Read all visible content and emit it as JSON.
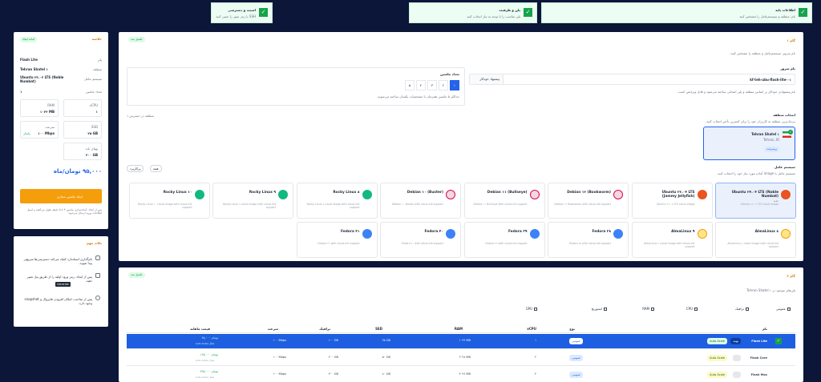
{
  "steps": [
    {
      "title": "اطلاعات پایه",
      "desc": "نام، منطقه و سیستم‌عامل را مشخص کنید"
    },
    {
      "title": "پلن و ظرفیت",
      "desc": "پلن مناسب را با توجه به نیاز انتخاب کنید"
    },
    {
      "title": "امنیت و دسترسی",
      "desc": "SSH یا رمز عبور را تعیین کنید"
    }
  ],
  "basic": {
    "step_pill": "تکمیل شد",
    "heading": "گام ۱",
    "subtitle": "نام سرور، سیستم‌عامل و منطقه را مشخص کنید.",
    "server_name_label": "نام سرور",
    "server_name_value": "kf-teh-ubu-flash-lite-۰۱",
    "auto_button": "پیشنهاد خودکار",
    "server_name_hint": "نام پیشنهادی خودکار بر اساس منطقه و پلن انتخابی ساخته می‌شود و قابل ویرایش است.",
    "count_label": "تعداد ماشین",
    "counts": [
      "۱",
      "۲",
      "۳",
      "۴",
      "۵"
    ],
    "count_selected_index": 0,
    "count_hint": "حداکثر ۵ ماشین همزمان با مشخصات یکسان ساخته می‌شوند.",
    "count_hint2": "۱ منطقه در دسترس",
    "region_label": "انتخاب منطقه",
    "region_desc": "نزدیک‌ترین منطقه به کاربران خود را برای کمترین تأخیر انتخاب کنید.",
    "region_name": "Tehran Shatel ۱",
    "region_sub": "Tehran, IR",
    "region_badge": "پرسرعت",
    "os_label": "سیستم عامل",
    "os_desc": "سیستم عامل یا image آماده مورد نیاز خود را انتخاب کنید.",
    "filter_all": "همه",
    "filter_popular": "پرکاربرد",
    "os_row1": [
      {
        "name": "Ubuntu ۲۴.۰۴ LTS (Noble Numbat)",
        "sub": "جدید",
        "desc": "Ubuntu ۲۴.۰۴ LTS cloud image",
        "cls": "ub",
        "sel": true
      },
      {
        "name": "Ubuntu ۲۲.۰۴ LTS (Jammy Jellyfish)",
        "sub": "",
        "desc": "Ubuntu ۲۲.۰۴ LTS cloud image",
        "cls": "ub",
        "sel": false
      },
      {
        "name": "Debian ۱۲ (Bookworm)",
        "sub": "",
        "desc": "Debian ۱۲ Bookworm with cloud-init support",
        "cls": "de",
        "sel": false
      },
      {
        "name": "Debian ۱۱ (Bullseye)",
        "sub": "",
        "desc": "Debian ۱۱ Bullseye with cloud-init support",
        "cls": "de",
        "sel": false
      },
      {
        "name": "Debian ۱۰ (Buster)",
        "sub": "",
        "desc": "Debian ۱۰ Buster with cloud-init support",
        "cls": "de",
        "sel": false
      },
      {
        "name": "Rocky Linux ۸",
        "sub": "",
        "desc": "Rocky Linux ۸ cloud image with cloud-init support",
        "cls": "rk",
        "sel": false
      },
      {
        "name": "Rocky Linux ۹",
        "sub": "",
        "desc": "Rocky Linux ۹ cloud image with cloud-init support",
        "cls": "rk",
        "sel": false
      },
      {
        "name": "Rocky Linux ۱۰",
        "sub": "",
        "desc": "Rocky Linux ۱۰ cloud image with cloud-init support",
        "cls": "rk",
        "sel": false
      }
    ],
    "os_row2": [
      {
        "name": "AlmaLinux ۸",
        "sub": "",
        "desc": "AlmaLinux ۸ cloud image with cloud-init support",
        "cls": "al"
      },
      {
        "name": "AlmaLinux ۹",
        "sub": "",
        "desc": "AlmaLinux ۹ cloud image with cloud-init support",
        "cls": "al"
      },
      {
        "name": "Fedora ۳۸",
        "sub": "",
        "desc": "Fedora ۳۸ with cloud-init support",
        "cls": "fe"
      },
      {
        "name": "Fedora ۳۹",
        "sub": "",
        "desc": "Fedora ۳۹ with cloud-init support",
        "cls": "fe"
      },
      {
        "name": "Fedora ۴۰",
        "sub": "",
        "desc": "Fedora ۴۰ with cloud-init support",
        "cls": "fe"
      },
      {
        "name": "Fedora ۴۱",
        "sub": "",
        "desc": "Fedora ۴۱ with cloud-init support",
        "cls": "fe"
      }
    ]
  },
  "plan": {
    "step_pill": "تکمیل شد",
    "heading": "گام ۲",
    "subtitle": "پلن‌های موجود در Tehran Shatel ۱",
    "filters": [
      "عمومی",
      "ترافیک",
      "CPU",
      "RAM",
      "استوریج",
      "GPU"
    ],
    "headers": [
      "نام",
      "نوع",
      "vCPU",
      "RAM",
      "SSD",
      "ترافیک",
      "سرعت",
      "قیمت ماهانه"
    ],
    "rows": [
      {
        "name": "Flash Lite",
        "tag": "بهینه",
        "badge2": "Auto-Scale",
        "type": "عمومی",
        "cpu": "۱",
        "ram": "۱۰۲۴ MB",
        "ssd": "۲۵ GB",
        "traffic": "۱۰۰ GB",
        "speed": "۱۰۰ Mbps",
        "price": "۹۵,۰۰۰ تومان",
        "price_sub": "Auto-Scale فعال"
      },
      {
        "name": "Flash Core",
        "tag": "",
        "badge2": "Auto-Scale",
        "type": "عمومی",
        "cpu": "۲",
        "ram": "۲۰۴۸ MB",
        "ssd": "۵۰ GB",
        "traffic": "۲۰۰ GB",
        "speed": "۱۰۰ Mbps",
        "price": "۱۶۵,۰۰۰ تومان",
        "price_sub": "Auto-Scale فعال"
      },
      {
        "name": "Flash Max",
        "tag": "",
        "badge2": "Auto-Scale",
        "type": "عمومی",
        "cpu": "۴",
        "ram": "۴۰۹۶ MB",
        "ssd": "۸۰ GB",
        "traffic": "۳۰۰ GB",
        "speed": "۱۰۰ Mbps",
        "price": "۲۹۵,۰۰۰ تومان",
        "price_sub": "Auto-Scale فعال"
      }
    ]
  },
  "summary": {
    "title": "خلاصه",
    "pill": "آماده ایجاد",
    "plan_label": "پلن",
    "plan_value": "Flash Lite",
    "region_label": "منطقه",
    "region_value": "Tehran Shatel ۱",
    "os_label": "سیستم عامل",
    "os_value": "Ubuntu ۲۴.۰۴ LTS (Noble Numbat)",
    "count_label": "تعداد ماشین",
    "count_value": "۱",
    "cpu_label": "vCPU",
    "cpu_value": "۱",
    "ram_label": "RAM",
    "ram_value": "۱۰۲۴ MB",
    "ssd_label": "SSD",
    "ssd_value": "۲۵ GB",
    "speed_label": "سرعت",
    "speed_value": "۱۰۰ Mbps",
    "speed_tag": "پایدار",
    "traffic_label": "پهنای باند",
    "traffic_value": "۲۰۰ GB",
    "price": "۹۵,۰۰۰ تومان/ماه",
    "cta": "ایجاد ماشین مجازی",
    "note": "پس از ایجاد، آماده‌سازی ماشین ۳ تا ۵ دقیقه طول می‌کشد و ایمیل اطلاعات ورود ارسال می‌شود."
  },
  "tips": {
    "title": "نکات مهم",
    "items": [
      "نام‌گذاری استاندارد کمک می‌کند دسترسی‌ها سریع‌تر پیدا شوند.",
      "پس از ایجاد، رمز ورود اولیه را از طریق پنل تغییر دهید.",
      "پس از ساخت، امکان افزودن فایروال و snapshot وجود دارد."
    ],
    "kbd": "Generate"
  }
}
